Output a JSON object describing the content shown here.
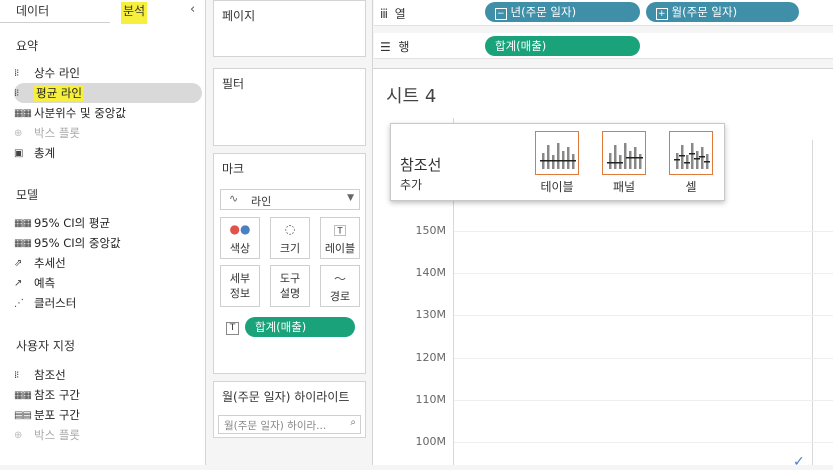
{
  "tabs": {
    "data": "데이터",
    "analysis": "분석"
  },
  "sections": [
    {
      "title": "요약",
      "items": [
        {
          "label": "상수 라인",
          "icon": "constant-line-icon",
          "disabled": false
        },
        {
          "label": "평균 라인",
          "icon": "average-line-icon",
          "disabled": false,
          "selected": true
        },
        {
          "label": "사분위수 및 중앙값",
          "icon": "quartile-icon",
          "disabled": false
        },
        {
          "label": "박스 플롯",
          "icon": "boxplot-icon",
          "disabled": true
        },
        {
          "label": "총계",
          "icon": "totals-icon",
          "disabled": false
        }
      ]
    },
    {
      "title": "모델",
      "items": [
        {
          "label": "95% CI의 평균",
          "icon": "ci-mean-icon",
          "disabled": false
        },
        {
          "label": "95% CI의 중앙값",
          "icon": "ci-median-icon",
          "disabled": false
        },
        {
          "label": "추세선",
          "icon": "trendline-icon",
          "disabled": false
        },
        {
          "label": "예측",
          "icon": "forecast-icon",
          "disabled": false
        },
        {
          "label": "클러스터",
          "icon": "cluster-icon",
          "disabled": false
        }
      ]
    },
    {
      "title": "사용자 지정",
      "items": [
        {
          "label": "참조선",
          "icon": "reference-line-icon",
          "disabled": false
        },
        {
          "label": "참조 구간",
          "icon": "reference-band-icon",
          "disabled": false
        },
        {
          "label": "분포 구간",
          "icon": "distribution-band-icon",
          "disabled": false
        },
        {
          "label": "박스 플롯",
          "icon": "boxplot-icon",
          "disabled": true
        }
      ]
    }
  ],
  "cards": {
    "pages": "페이지",
    "filters": "필터",
    "marks": "마크",
    "highlight": "월(주문 일자) 하이라이트"
  },
  "marks": {
    "type": "라인",
    "buttons": [
      "색상",
      "크기",
      "레이블",
      "세부\n정보",
      "도구\n설명",
      "경로"
    ],
    "pill": "합계(매출)"
  },
  "highlight_placeholder": "월(주문 일자) 하이라...",
  "shelves": {
    "columns_label": "열",
    "rows_label": "행",
    "column_pills": [
      "년(주문 일자)",
      "월(주문 일자)"
    ],
    "row_pills": [
      "합계(매출)"
    ]
  },
  "sheet": {
    "title": "시트 4"
  },
  "popup": {
    "title": "참조선",
    "subtitle": "추가",
    "options": [
      "테이블",
      "패널",
      "셀"
    ]
  },
  "yaxis": {
    "ticks": [
      "150M",
      "140M",
      "130M",
      "120M",
      "110M",
      "100M"
    ]
  },
  "colors": {
    "accent": "#f7ef3e",
    "pill_blue": "#3f8fa9",
    "pill_green": "#1aa27a",
    "option_border": "#e07a3c"
  }
}
